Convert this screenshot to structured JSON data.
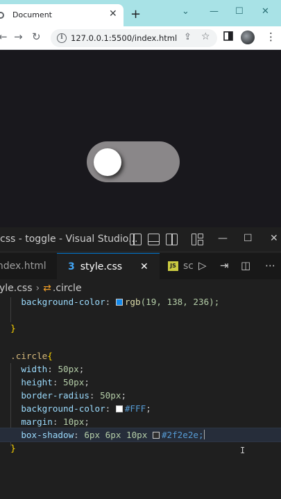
{
  "browser": {
    "tab_title": "Document",
    "tab_close": "✕",
    "new_tab": "+",
    "url": "127.0.0.1:5500/index.html",
    "info_glyph": "i",
    "window_controls": [
      "⌄",
      "—",
      "☐",
      "✕"
    ],
    "nav": {
      "back": "←",
      "forward": "→",
      "reload": "↻"
    },
    "toggle": {
      "state": "off",
      "track_color": "#8a8789",
      "knob_color": "#ffffff"
    }
  },
  "vscode": {
    "title": "css - toggle - Visual Studio...",
    "window_controls": [
      "—",
      "☐",
      "✕"
    ],
    "tabs": [
      {
        "label": "index.html",
        "active": false
      },
      {
        "label": "style.css",
        "active": true
      },
      {
        "label": "sc",
        "active": false
      }
    ],
    "css_icon": "3",
    "js_icon": "JS",
    "tab_close": "✕",
    "run_icon": "▷",
    "split_icon": "◫",
    "breadcrumb": {
      "file": "yle.css",
      "separator": "›",
      "symbol_icon": "⇄",
      "symbol": ".circle"
    },
    "code": {
      "line1_prop": "background-color",
      "line1_fn": "rgb",
      "line1_args": "(19, 138, 236);",
      "swatch1": "#138aec",
      "close1": "}",
      "selector": ".circle",
      "open_brace": "{",
      "props": [
        {
          "name": "width",
          "value": "50px"
        },
        {
          "name": "height",
          "value": "50px"
        },
        {
          "name": "border-radius",
          "value": "50px"
        },
        {
          "name": "background-color",
          "value": "#FFF",
          "swatch": "#ffffff"
        },
        {
          "name": "margin",
          "value": "10px"
        },
        {
          "name": "box-shadow",
          "value": "6px 6px 10px",
          "color": "#2f2e2e;",
          "swatch": "#2f2e2e"
        }
      ],
      "close2": "}"
    },
    "ibeam": "I"
  }
}
